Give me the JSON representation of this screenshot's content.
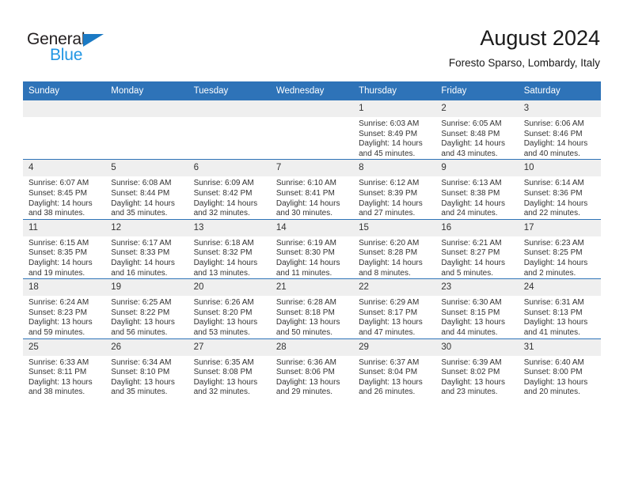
{
  "brand": {
    "name_top": "General",
    "name_bottom": "Blue",
    "accent_color": "#2196e3",
    "triangle_color": "#1b7ac4"
  },
  "header": {
    "title": "August 2024",
    "subtitle": "Foresto Sparso, Lombardy, Italy"
  },
  "theme": {
    "header_band": "#2e73b8",
    "daynum_band": "#efefef",
    "text": "#333333"
  },
  "weekdays": [
    "Sunday",
    "Monday",
    "Tuesday",
    "Wednesday",
    "Thursday",
    "Friday",
    "Saturday"
  ],
  "weeks": [
    [
      {
        "day": "",
        "lines": []
      },
      {
        "day": "",
        "lines": []
      },
      {
        "day": "",
        "lines": []
      },
      {
        "day": "",
        "lines": []
      },
      {
        "day": "1",
        "lines": [
          "Sunrise: 6:03 AM",
          "Sunset: 8:49 PM",
          "Daylight: 14 hours",
          "and 45 minutes."
        ]
      },
      {
        "day": "2",
        "lines": [
          "Sunrise: 6:05 AM",
          "Sunset: 8:48 PM",
          "Daylight: 14 hours",
          "and 43 minutes."
        ]
      },
      {
        "day": "3",
        "lines": [
          "Sunrise: 6:06 AM",
          "Sunset: 8:46 PM",
          "Daylight: 14 hours",
          "and 40 minutes."
        ]
      }
    ],
    [
      {
        "day": "4",
        "lines": [
          "Sunrise: 6:07 AM",
          "Sunset: 8:45 PM",
          "Daylight: 14 hours",
          "and 38 minutes."
        ]
      },
      {
        "day": "5",
        "lines": [
          "Sunrise: 6:08 AM",
          "Sunset: 8:44 PM",
          "Daylight: 14 hours",
          "and 35 minutes."
        ]
      },
      {
        "day": "6",
        "lines": [
          "Sunrise: 6:09 AM",
          "Sunset: 8:42 PM",
          "Daylight: 14 hours",
          "and 32 minutes."
        ]
      },
      {
        "day": "7",
        "lines": [
          "Sunrise: 6:10 AM",
          "Sunset: 8:41 PM",
          "Daylight: 14 hours",
          "and 30 minutes."
        ]
      },
      {
        "day": "8",
        "lines": [
          "Sunrise: 6:12 AM",
          "Sunset: 8:39 PM",
          "Daylight: 14 hours",
          "and 27 minutes."
        ]
      },
      {
        "day": "9",
        "lines": [
          "Sunrise: 6:13 AM",
          "Sunset: 8:38 PM",
          "Daylight: 14 hours",
          "and 24 minutes."
        ]
      },
      {
        "day": "10",
        "lines": [
          "Sunrise: 6:14 AM",
          "Sunset: 8:36 PM",
          "Daylight: 14 hours",
          "and 22 minutes."
        ]
      }
    ],
    [
      {
        "day": "11",
        "lines": [
          "Sunrise: 6:15 AM",
          "Sunset: 8:35 PM",
          "Daylight: 14 hours",
          "and 19 minutes."
        ]
      },
      {
        "day": "12",
        "lines": [
          "Sunrise: 6:17 AM",
          "Sunset: 8:33 PM",
          "Daylight: 14 hours",
          "and 16 minutes."
        ]
      },
      {
        "day": "13",
        "lines": [
          "Sunrise: 6:18 AM",
          "Sunset: 8:32 PM",
          "Daylight: 14 hours",
          "and 13 minutes."
        ]
      },
      {
        "day": "14",
        "lines": [
          "Sunrise: 6:19 AM",
          "Sunset: 8:30 PM",
          "Daylight: 14 hours",
          "and 11 minutes."
        ]
      },
      {
        "day": "15",
        "lines": [
          "Sunrise: 6:20 AM",
          "Sunset: 8:28 PM",
          "Daylight: 14 hours",
          "and 8 minutes."
        ]
      },
      {
        "day": "16",
        "lines": [
          "Sunrise: 6:21 AM",
          "Sunset: 8:27 PM",
          "Daylight: 14 hours",
          "and 5 minutes."
        ]
      },
      {
        "day": "17",
        "lines": [
          "Sunrise: 6:23 AM",
          "Sunset: 8:25 PM",
          "Daylight: 14 hours",
          "and 2 minutes."
        ]
      }
    ],
    [
      {
        "day": "18",
        "lines": [
          "Sunrise: 6:24 AM",
          "Sunset: 8:23 PM",
          "Daylight: 13 hours",
          "and 59 minutes."
        ]
      },
      {
        "day": "19",
        "lines": [
          "Sunrise: 6:25 AM",
          "Sunset: 8:22 PM",
          "Daylight: 13 hours",
          "and 56 minutes."
        ]
      },
      {
        "day": "20",
        "lines": [
          "Sunrise: 6:26 AM",
          "Sunset: 8:20 PM",
          "Daylight: 13 hours",
          "and 53 minutes."
        ]
      },
      {
        "day": "21",
        "lines": [
          "Sunrise: 6:28 AM",
          "Sunset: 8:18 PM",
          "Daylight: 13 hours",
          "and 50 minutes."
        ]
      },
      {
        "day": "22",
        "lines": [
          "Sunrise: 6:29 AM",
          "Sunset: 8:17 PM",
          "Daylight: 13 hours",
          "and 47 minutes."
        ]
      },
      {
        "day": "23",
        "lines": [
          "Sunrise: 6:30 AM",
          "Sunset: 8:15 PM",
          "Daylight: 13 hours",
          "and 44 minutes."
        ]
      },
      {
        "day": "24",
        "lines": [
          "Sunrise: 6:31 AM",
          "Sunset: 8:13 PM",
          "Daylight: 13 hours",
          "and 41 minutes."
        ]
      }
    ],
    [
      {
        "day": "25",
        "lines": [
          "Sunrise: 6:33 AM",
          "Sunset: 8:11 PM",
          "Daylight: 13 hours",
          "and 38 minutes."
        ]
      },
      {
        "day": "26",
        "lines": [
          "Sunrise: 6:34 AM",
          "Sunset: 8:10 PM",
          "Daylight: 13 hours",
          "and 35 minutes."
        ]
      },
      {
        "day": "27",
        "lines": [
          "Sunrise: 6:35 AM",
          "Sunset: 8:08 PM",
          "Daylight: 13 hours",
          "and 32 minutes."
        ]
      },
      {
        "day": "28",
        "lines": [
          "Sunrise: 6:36 AM",
          "Sunset: 8:06 PM",
          "Daylight: 13 hours",
          "and 29 minutes."
        ]
      },
      {
        "day": "29",
        "lines": [
          "Sunrise: 6:37 AM",
          "Sunset: 8:04 PM",
          "Daylight: 13 hours",
          "and 26 minutes."
        ]
      },
      {
        "day": "30",
        "lines": [
          "Sunrise: 6:39 AM",
          "Sunset: 8:02 PM",
          "Daylight: 13 hours",
          "and 23 minutes."
        ]
      },
      {
        "day": "31",
        "lines": [
          "Sunrise: 6:40 AM",
          "Sunset: 8:00 PM",
          "Daylight: 13 hours",
          "and 20 minutes."
        ]
      }
    ]
  ]
}
